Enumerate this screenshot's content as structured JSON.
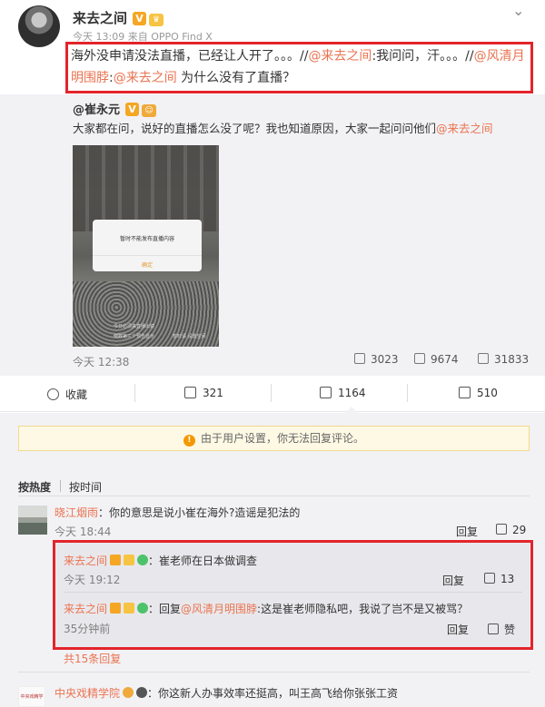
{
  "post": {
    "author": "来去之间",
    "meta": "今天 13:09 来自 OPPO Find X",
    "text_prefix": "海外没申请没法直播，已经让人开了。。。//",
    "mention1": "@来去之间",
    "text_mid1": ":我问问，汗。。。//",
    "mention2": "@风清月明围脖",
    "text_mid2": ":",
    "mention3": "@来去之间",
    "text_suffix": " 为什么没有了直播？"
  },
  "repost": {
    "author": "@崔永元",
    "text_prefix": "大家都在问，说好的直播怎么没了呢？我也知道原因，大家一起问问他们",
    "mention": "@来去之间",
    "image": {
      "dialog_message": "暂时不能发布直播内容",
      "dialog_button": "确定",
      "caption1": "今日必须来直播出镜",
      "caption2": "倒数第三个预告显示",
      "caption3": "暂时请 设置空间"
    },
    "time": "今天 12:38",
    "shares": "3023",
    "comments": "9674",
    "likes": "31833"
  },
  "actions": {
    "favorite": "收藏",
    "repost": "321",
    "comment": "1164",
    "like": "510"
  },
  "notice": "由于用户设置，你无法回复评论。",
  "sort": {
    "hot": "按热度",
    "time": "按时间"
  },
  "comment": {
    "user": "晓江烟雨",
    "text": "：你的意思是说小崔在海外?造谣是犯法的",
    "time": "今天 18:44",
    "reply_label": "回复",
    "likes": "29"
  },
  "replies": [
    {
      "user": "来去之间",
      "text": "：崔老师在日本做调查",
      "time": "今天 19:12",
      "reply_label": "回复",
      "likes": "13"
    },
    {
      "user": "来去之间",
      "text_prefix": "：回复",
      "mention": "@风清月明围脖",
      "text_suffix": ":这是崔老师隐私吧，我说了岂不是又被骂？",
      "time": "35分钟前",
      "reply_label": "回复",
      "likes": "赞"
    }
  ],
  "more_replies": "共15条回复",
  "bottom_comment": {
    "user": "中央戏精学院",
    "avatar_text": "中央戏精学院",
    "text": "：你这新人办事效率还挺高，叫王高飞给你张张工资"
  },
  "colors": {
    "link": "#eb7350",
    "highlight_box": "#e3242b",
    "v_badge": "#f5a623"
  }
}
